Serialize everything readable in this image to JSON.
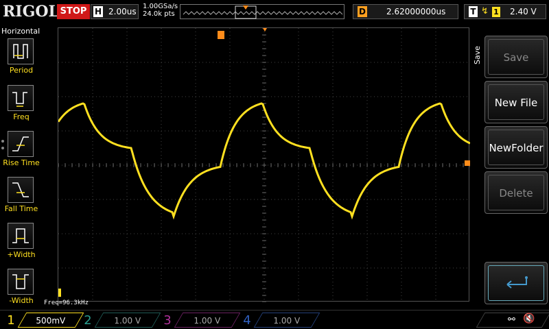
{
  "brand": "RIGOL",
  "run_state": "STOP",
  "horizontal": {
    "key": "H",
    "timebase": "2.00us"
  },
  "sampling": {
    "rate": "1.00GSa/s",
    "points": "24.0k pts"
  },
  "delay": {
    "key": "D",
    "value": "2.62000000us"
  },
  "trigger": {
    "key": "T",
    "edge_icon": "rising-edge-icon",
    "source": "1",
    "level": "2.40 V"
  },
  "left_menu": {
    "title": "Horizontal",
    "items": [
      {
        "label": "Period",
        "icon": "period-measure-icon"
      },
      {
        "label": "Freq",
        "icon": "frequency-measure-icon"
      },
      {
        "label": "Rise Time",
        "icon": "rise-time-icon"
      },
      {
        "label": "Fall Time",
        "icon": "fall-time-icon"
      },
      {
        "label": "+Width",
        "icon": "positive-width-icon"
      },
      {
        "label": "-Width",
        "icon": "negative-width-icon"
      }
    ]
  },
  "measurement": "Freq=96.3kHz",
  "right_menu": {
    "title": "Save",
    "items": [
      {
        "label": "Save",
        "enabled": false
      },
      {
        "label": "New File",
        "enabled": true
      },
      {
        "label": "NewFolder",
        "enabled": true
      },
      {
        "label": "Delete",
        "enabled": false
      }
    ],
    "enter_icon": "enter-return-icon"
  },
  "channels": [
    {
      "num": "1",
      "scale": "500mV",
      "color": "#ffe020",
      "active": true
    },
    {
      "num": "2",
      "scale": "1.00 V",
      "color": "#2a9d8f",
      "active": false
    },
    {
      "num": "3",
      "scale": "1.00 V",
      "color": "#b0309a",
      "active": false
    },
    {
      "num": "4",
      "scale": "1.00 V",
      "color": "#3060c0",
      "active": false
    }
  ],
  "status_icons": {
    "usb": "usb-icon",
    "sound": "speaker-muted-icon"
  },
  "colors": {
    "ch1": "#ffe020",
    "trigger_marker": "#ff8c1a",
    "stop": "#d01818"
  }
}
